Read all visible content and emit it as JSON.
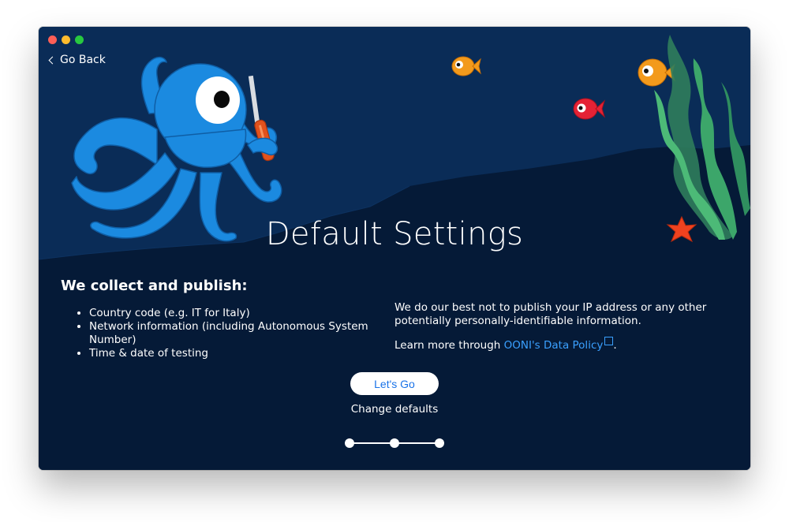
{
  "window": {
    "background": "#07203f",
    "controls": [
      "close-button",
      "minimize-button",
      "zoom-button"
    ]
  },
  "nav": {
    "back_label": "Go Back"
  },
  "page": {
    "title": "Default Settings"
  },
  "collect": {
    "heading": "We collect and publish:",
    "items": [
      "Country code (e.g. IT for Italy)",
      "Network information (including Autonomous System Number)",
      "Time & date of testing"
    ]
  },
  "privacy": {
    "paragraph": "We do our best not to publish your IP address or any other potentially personally-identifiable information.",
    "learn_prefix": "Learn more through ",
    "policy_link": "OONI's Data Policy",
    "learn_suffix": "."
  },
  "actions": {
    "primary_label": "Let's Go",
    "secondary_label": "Change defaults"
  },
  "stepper": {
    "steps": 3
  },
  "colors": {
    "accent_link": "#3aa0ff",
    "button_text": "#1a73e8",
    "octopus": "#1b8ae0",
    "fish_orange": "#f39a1c",
    "fish_red": "#e52235",
    "seaweed": "#3ca66a",
    "starfish": "#f0421f"
  }
}
